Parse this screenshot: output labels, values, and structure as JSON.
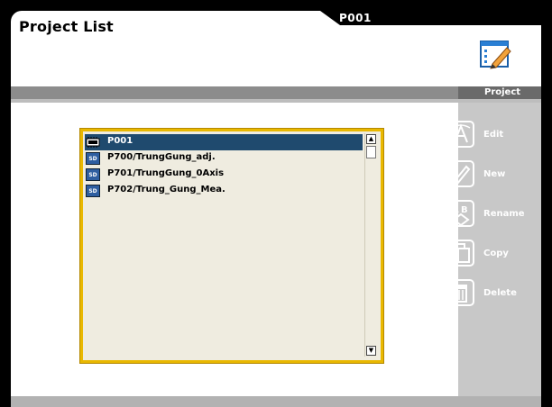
{
  "header": {
    "title": "Project List",
    "current_project": "P001",
    "window_icon": "edit-window-icon"
  },
  "side_panel": {
    "heading": "Project",
    "actions": [
      {
        "label": "Edit",
        "icon": "edit-icon"
      },
      {
        "label": "New",
        "icon": "pencil-icon"
      },
      {
        "label": "Rename",
        "icon": "rename-icon"
      },
      {
        "label": "Copy",
        "icon": "copy-icon"
      },
      {
        "label": "Delete",
        "icon": "trash-icon"
      }
    ]
  },
  "project_list": {
    "items": [
      {
        "label": "P001",
        "storage": "internal",
        "selected": true
      },
      {
        "label": "P700/TrungGung_adj.",
        "storage": "SD",
        "selected": false
      },
      {
        "label": "P701/TrungGung_0Axis",
        "storage": "SD",
        "selected": false
      },
      {
        "label": "P702/Trung_Gung_Mea.",
        "storage": "SD",
        "selected": false
      }
    ],
    "sd_badge_text": "SD"
  },
  "colors": {
    "accent_yellow": "#e9b800",
    "selection_blue": "#1f4a6e",
    "panel_gray": "#c8c8c8"
  }
}
